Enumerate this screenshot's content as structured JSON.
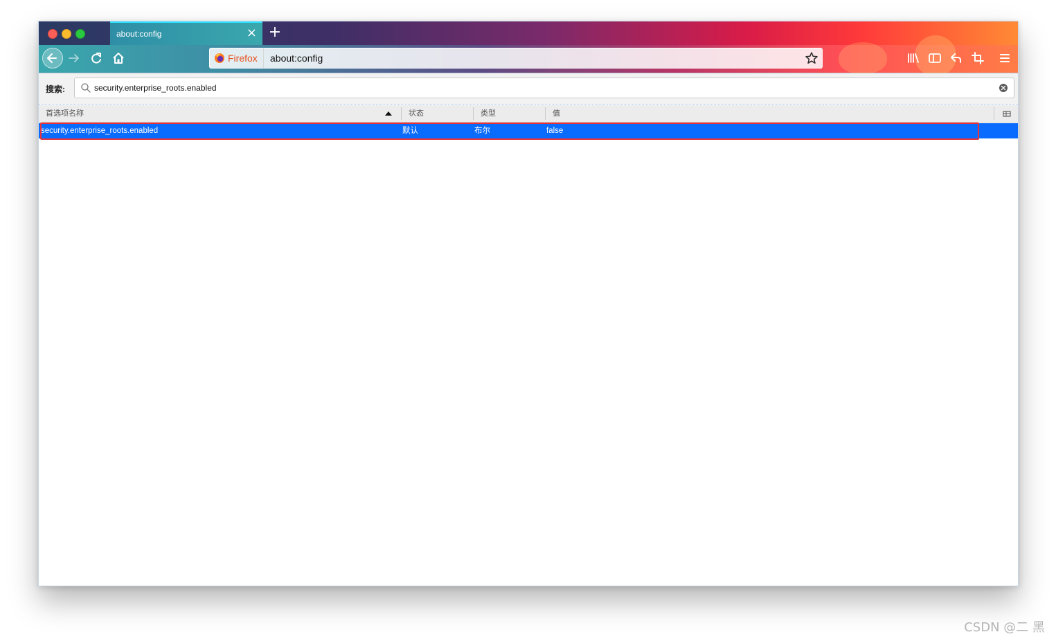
{
  "tab": {
    "title": "about:config",
    "close_symbol": "×",
    "new_tab_symbol": "+"
  },
  "urlbar": {
    "identity_label": "Firefox",
    "url": "about:config"
  },
  "icons": {
    "back": "arrow-left-icon",
    "forward": "arrow-right-icon",
    "reload": "reload-icon",
    "home": "home-icon",
    "bookmark": "star-icon",
    "library": "library-icon",
    "sidebar": "sidebar-icon",
    "undo": "undo-icon",
    "screenshot": "crop-icon",
    "menu": "hamburger-menu-icon"
  },
  "search": {
    "label": "搜索:",
    "value": "security.enterprise_roots.enabled"
  },
  "columns": {
    "name": "首选项名称",
    "status": "状态",
    "type": "类型",
    "value": "值"
  },
  "rows": [
    {
      "name": "security.enterprise_roots.enabled",
      "status": "默认",
      "type": "布尔",
      "value": "false"
    }
  ],
  "colors": {
    "selection": "#0a6cff",
    "highlight_outline": "#e8323a",
    "identity_orange": "#e8511f"
  },
  "watermark": "CSDN @二 黑"
}
